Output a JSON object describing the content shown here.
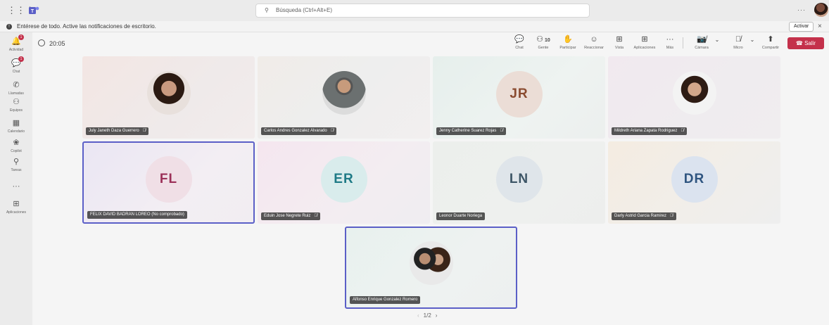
{
  "topbar": {
    "search_placeholder": "Búsqueda (Ctrl+Alt+E)",
    "more": "···"
  },
  "notification": {
    "text": "Entérese de todo. Active las notificaciones de escritorio.",
    "activate": "Activar",
    "close": "×"
  },
  "rail": {
    "items": [
      {
        "label": "Actividad",
        "icon": "bell-icon",
        "glyph": "🔔",
        "badge": "1"
      },
      {
        "label": "Chat",
        "icon": "chat-icon",
        "glyph": "💬",
        "badge": "1"
      },
      {
        "label": "Llamadas",
        "icon": "phone-icon",
        "glyph": "✆",
        "badge": ""
      },
      {
        "label": "Equipos",
        "icon": "teams-icon",
        "glyph": "⚇",
        "badge": ""
      },
      {
        "label": "Calendario",
        "icon": "calendar-icon",
        "glyph": "▦",
        "badge": ""
      },
      {
        "label": "Copilot",
        "icon": "copilot-icon",
        "glyph": "❀",
        "badge": ""
      },
      {
        "label": "Tareas",
        "icon": "tasks-icon",
        "glyph": "⚲",
        "badge": ""
      },
      {
        "label": "",
        "icon": "more-icon",
        "glyph": "···",
        "badge": ""
      },
      {
        "label": "Aplicaciones",
        "icon": "apps-icon",
        "glyph": "⊞",
        "badge": ""
      }
    ]
  },
  "meeting": {
    "timer": "20:05",
    "toolbar": {
      "chat": "Chat",
      "people": "Gente",
      "people_count": "10",
      "raise": "Participar",
      "react": "Reaccionar",
      "view": "Vista",
      "apps": "Aplicaciones",
      "more": "Más",
      "camera": "Cámara",
      "mic": "Micro",
      "share": "Compartir",
      "leave": "Salir"
    },
    "accent": "#5b5fc7",
    "leave_color": "#c4314b"
  },
  "participants": [
    {
      "name": "July Janeth Daza Guerrero",
      "initials": "",
      "muted": true,
      "photo": "woman-dark-hair"
    },
    {
      "name": "Carlos Andres Gonzalez Alvarado",
      "initials": "",
      "muted": true,
      "photo": "man-thumbs-up"
    },
    {
      "name": "Jenny Catherine Suarez Rojas",
      "initials": "JR",
      "muted": true,
      "photo": ""
    },
    {
      "name": "Mildreth Ariana Zapata Rodriguez",
      "initials": "",
      "muted": true,
      "photo": "woman-smiling"
    },
    {
      "name": "FELIX DAVID BADRAN LOREO (No comprobado)",
      "initials": "FL",
      "muted": false,
      "photo": ""
    },
    {
      "name": "Eduin Jose Negrete Ruiz",
      "initials": "ER",
      "muted": true,
      "photo": ""
    },
    {
      "name": "Leonor Duarte Noriega",
      "initials": "LN",
      "muted": false,
      "photo": ""
    },
    {
      "name": "Darly Astrid Garcia Ramirez",
      "initials": "DR",
      "muted": true,
      "photo": ""
    },
    {
      "name": "Alfonso Enrique Gonzalez Romero",
      "initials": "",
      "muted": false,
      "photo": "couple"
    }
  ],
  "pager": {
    "prev": "‹",
    "page": "1/2",
    "next": "›"
  }
}
